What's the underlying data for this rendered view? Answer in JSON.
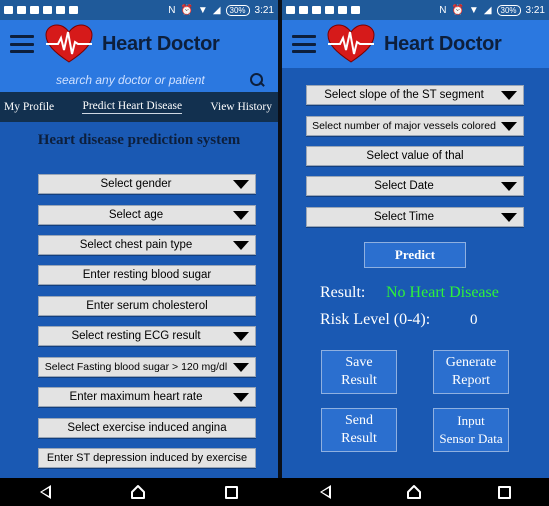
{
  "status_bar": {
    "battery": "30%",
    "time": "3:21"
  },
  "app": {
    "title": "Heart Doctor"
  },
  "search": {
    "placeholder": "search any doctor or patient"
  },
  "tabs": [
    {
      "label": "My Profile"
    },
    {
      "label": "Predict Heart Disease"
    },
    {
      "label": "View History"
    }
  ],
  "left_form": {
    "heading": "Heart disease prediction system",
    "fields": [
      {
        "label": "Select gender",
        "dropdown": true
      },
      {
        "label": "Select age",
        "dropdown": true
      },
      {
        "label": "Select chest pain type",
        "dropdown": true
      },
      {
        "label": "Enter resting blood sugar",
        "dropdown": false
      },
      {
        "label": "Enter serum cholesterol",
        "dropdown": false
      },
      {
        "label": "Select resting ECG result",
        "dropdown": true
      },
      {
        "label": "Select Fasting blood sugar > 120 mg/dl",
        "dropdown": true
      },
      {
        "label": "Enter maximum heart rate",
        "dropdown": true
      },
      {
        "label": "Select exercise induced angina",
        "dropdown": false
      },
      {
        "label": "Enter ST depression induced by exercise",
        "dropdown": false
      }
    ]
  },
  "right_form": {
    "fields": [
      {
        "label": "Select slope of the ST segment",
        "dropdown": true
      },
      {
        "label": "Select number of major vessels colored",
        "dropdown": true
      },
      {
        "label": "Select value of thal",
        "dropdown": false
      },
      {
        "label": "Select Date",
        "dropdown": true
      },
      {
        "label": "Select Time",
        "dropdown": true
      }
    ],
    "predict_label": "Predict",
    "result_label": "Result:",
    "result_value": "No Heart Disease",
    "risk_label": "Risk Level (0-4):",
    "risk_value": "0",
    "actions": [
      {
        "label": "Save\nResult"
      },
      {
        "label": "Generate\nReport"
      },
      {
        "label": "Send\nResult"
      },
      {
        "label": "Input\nSensor Data"
      }
    ]
  },
  "colors": {
    "background": "#1a59b3",
    "app_bar": "#2b78e0",
    "tab_bar": "#12304f",
    "result_green": "#2ef23a"
  }
}
